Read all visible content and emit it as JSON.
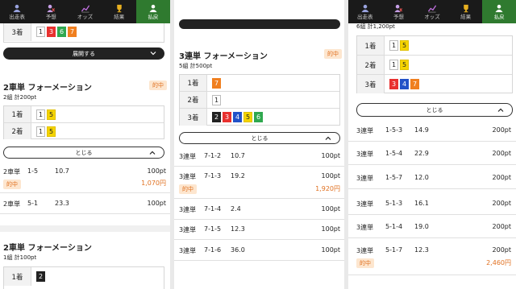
{
  "nav": [
    {
      "label": "出走表",
      "icon": "person-icon"
    },
    {
      "label": "予想",
      "icon": "prediction-icon"
    },
    {
      "label": "オッズ",
      "icon": "chart-icon"
    },
    {
      "label": "結果",
      "icon": "trophy-icon"
    },
    {
      "label": "払戻",
      "icon": "money-icon"
    }
  ],
  "colors": {
    "hit": "#e07020",
    "nav_active": "#2f7a2f"
  },
  "p1": {
    "top_rank": {
      "label": "3着",
      "chips": [
        "1",
        "3",
        "6",
        "7"
      ]
    },
    "expand_label": "展開する",
    "sec1": {
      "title": "2車単 フォーメーション",
      "sub": "2組 計200pt",
      "badge": "的中",
      "ranks": [
        {
          "label": "1着",
          "chips": [
            "1",
            "5"
          ]
        },
        {
          "label": "2着",
          "chips": [
            "1",
            "5"
          ]
        }
      ]
    },
    "close_label": "とじる",
    "results": [
      {
        "type": "2車単",
        "combo": "1-5",
        "odds": "10.7",
        "stake": "100pt",
        "hit": "的中",
        "payout": "1,070円"
      },
      {
        "type": "2車単",
        "combo": "5-1",
        "odds": "23.3",
        "stake": "100pt"
      }
    ],
    "sec2": {
      "title": "2車単 フォーメーション",
      "sub": "1組 計100pt",
      "rank": {
        "label": "1着",
        "chips": [
          "2"
        ]
      }
    }
  },
  "p2": {
    "sec": {
      "title": "3連単 フォーメーション",
      "sub": "5組 計500pt",
      "badge": "的中",
      "ranks": [
        {
          "label": "1着",
          "chips": [
            "7"
          ]
        },
        {
          "label": "2着",
          "chips": [
            "1"
          ]
        },
        {
          "label": "3着",
          "chips": [
            "2",
            "3",
            "4",
            "5",
            "6"
          ]
        }
      ]
    },
    "close_label": "とじる",
    "results": [
      {
        "type": "3連単",
        "combo": "7-1-2",
        "odds": "10.7",
        "stake": "100pt"
      },
      {
        "type": "3連単",
        "combo": "7-1-3",
        "odds": "19.2",
        "stake": "100pt",
        "hit": "的中",
        "payout": "1,920円"
      },
      {
        "type": "3連単",
        "combo": "7-1-4",
        "odds": "2.4",
        "stake": "100pt"
      },
      {
        "type": "3連単",
        "combo": "7-1-5",
        "odds": "12.3",
        "stake": "100pt"
      },
      {
        "type": "3連単",
        "combo": "7-1-6",
        "odds": "36.0",
        "stake": "100pt"
      }
    ]
  },
  "p3": {
    "sub": "6組 計1,200pt",
    "ranks": [
      {
        "label": "1着",
        "chips": [
          "1",
          "5"
        ]
      },
      {
        "label": "2着",
        "chips": [
          "1",
          "5"
        ]
      },
      {
        "label": "3着",
        "chips": [
          "3",
          "4",
          "7"
        ]
      }
    ],
    "close_label": "とじる",
    "results": [
      {
        "type": "3連単",
        "combo": "1-5-3",
        "odds": "14.9",
        "stake": "200pt"
      },
      {
        "type": "3連単",
        "combo": "1-5-4",
        "odds": "22.9",
        "stake": "200pt"
      },
      {
        "type": "3連単",
        "combo": "1-5-7",
        "odds": "12.0",
        "stake": "200pt"
      },
      {
        "type": "3連単",
        "combo": "5-1-3",
        "odds": "16.1",
        "stake": "200pt"
      },
      {
        "type": "3連単",
        "combo": "5-1-4",
        "odds": "19.0",
        "stake": "200pt"
      },
      {
        "type": "3連単",
        "combo": "5-1-7",
        "odds": "12.3",
        "stake": "200pt",
        "hit": "的中",
        "payout": "2,460円"
      }
    ]
  }
}
